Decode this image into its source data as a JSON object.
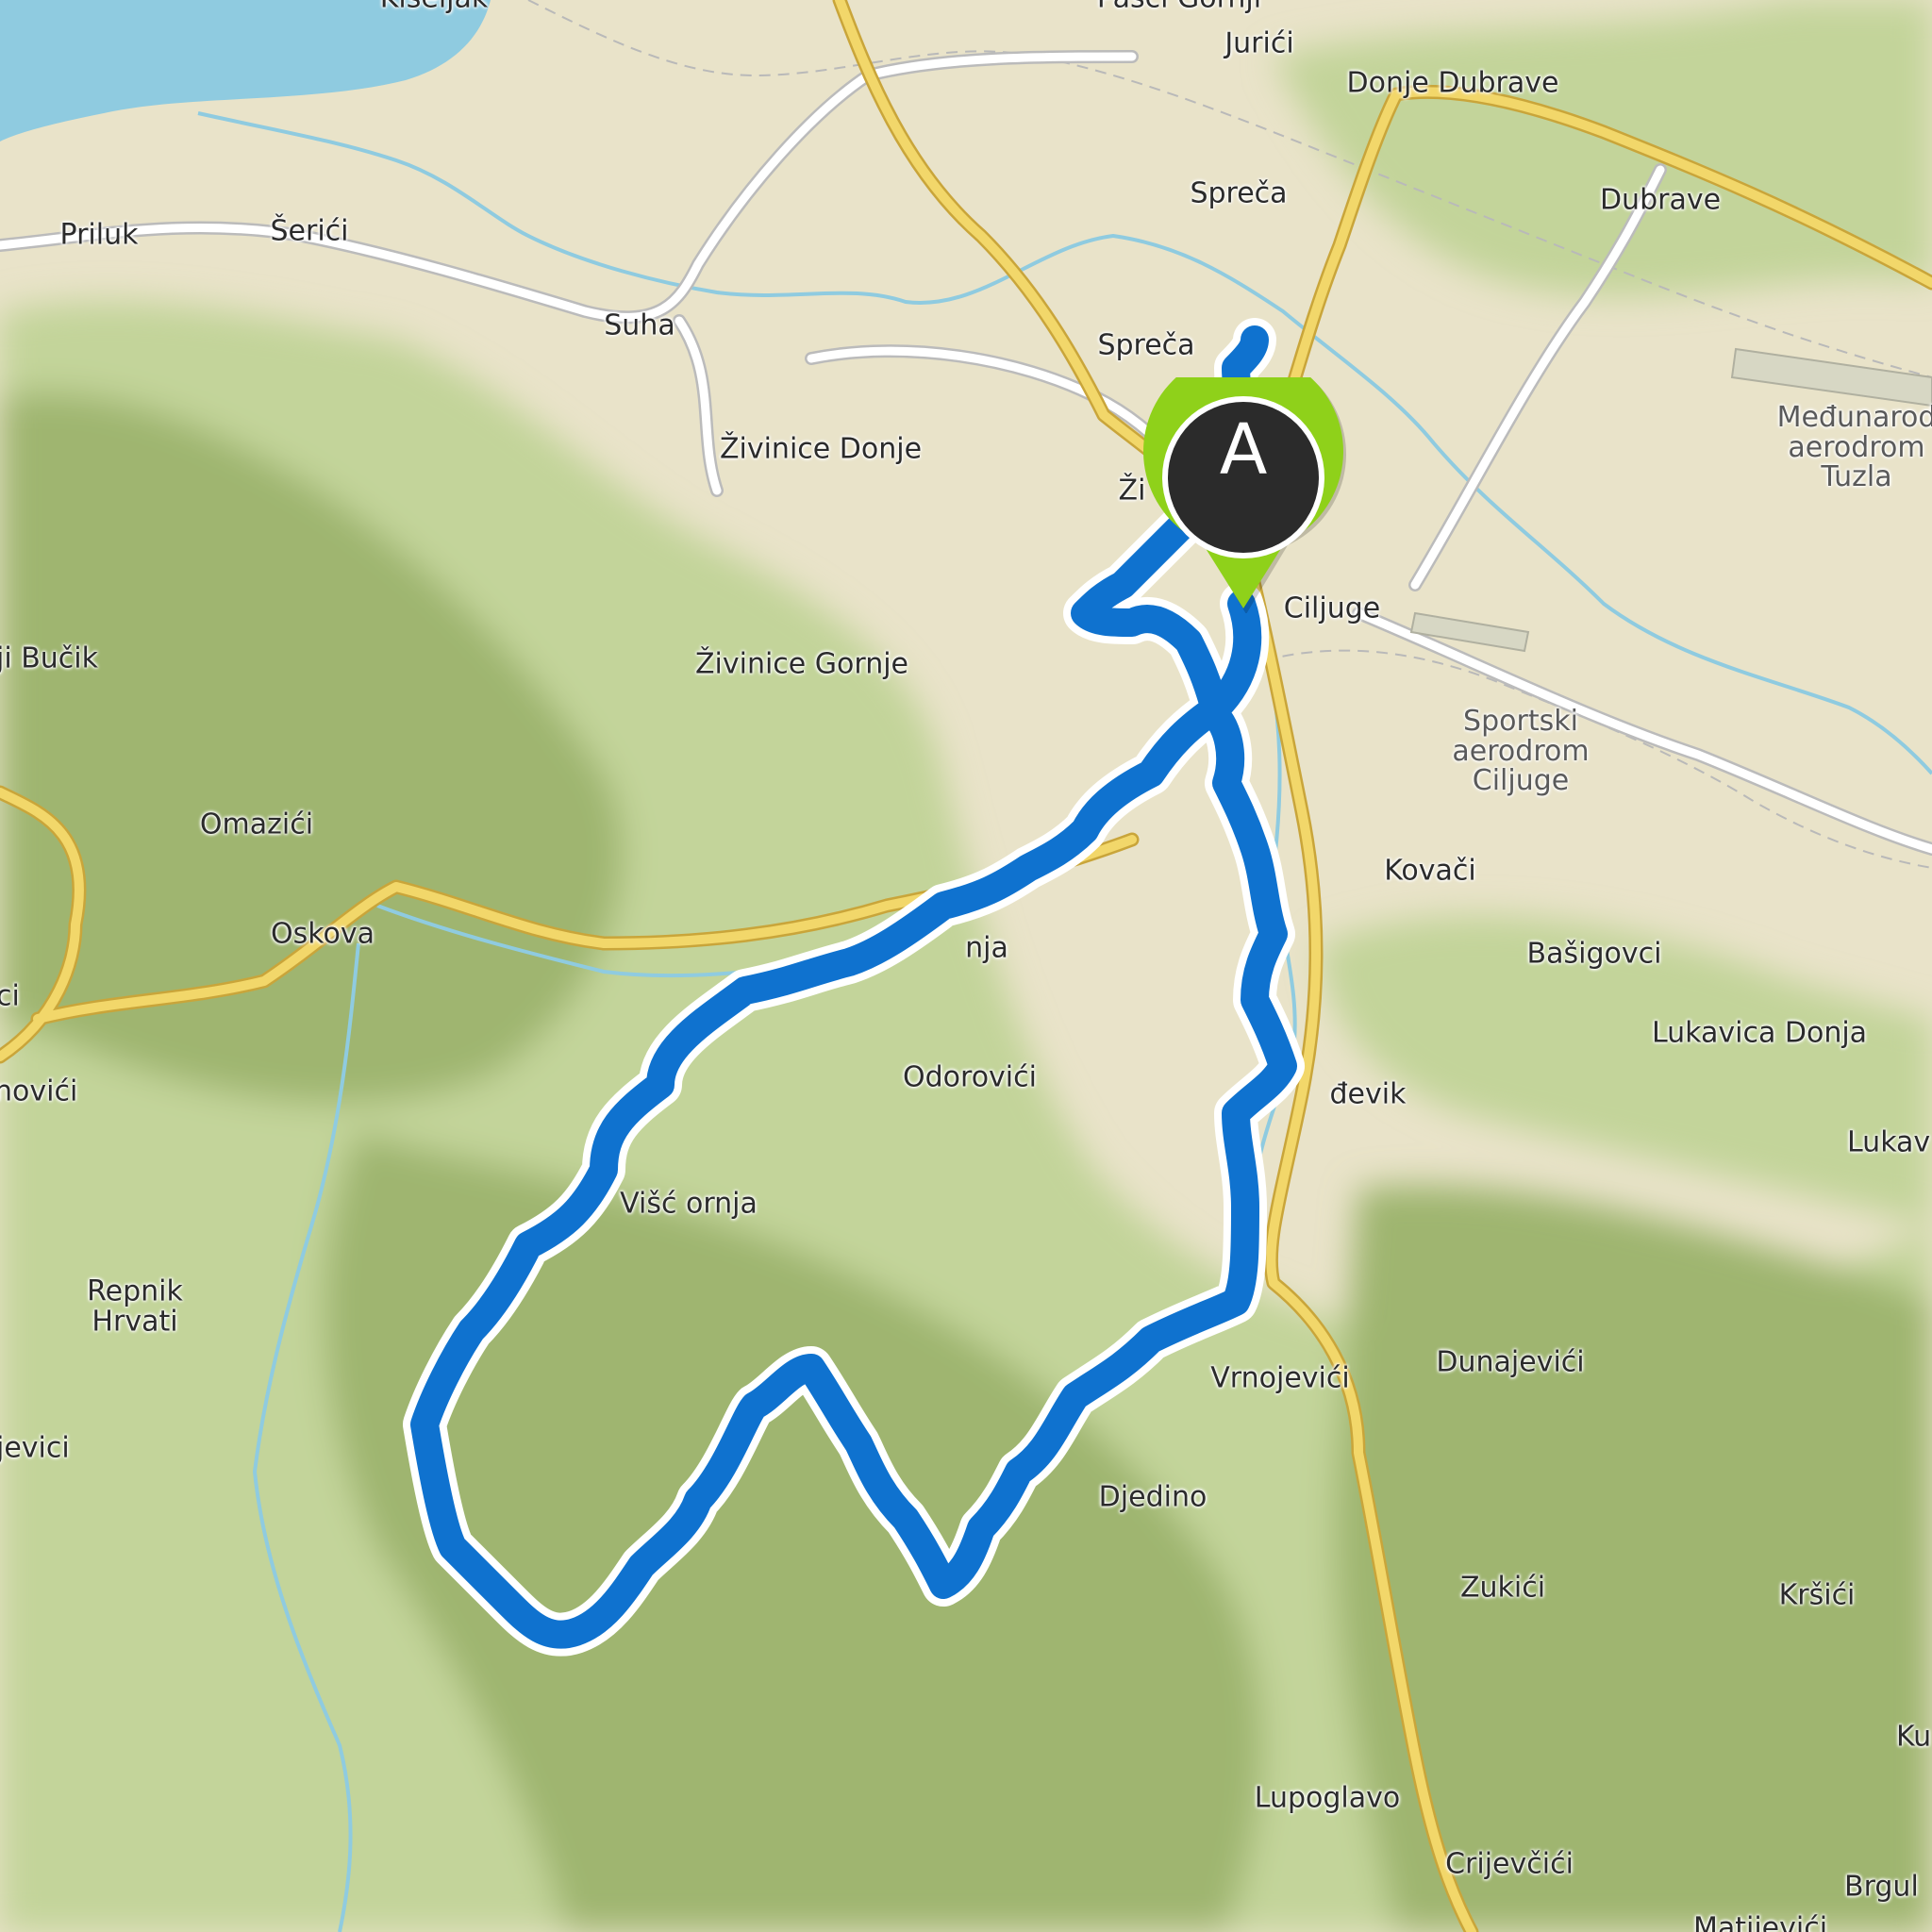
{
  "map": {
    "colors": {
      "lowland": "#e9e3c9",
      "forest": "#c3d49a",
      "forest_dark": "#9fb56f",
      "water": "#8fcbe0",
      "road_major": "#f2d76a",
      "road_minor": "#ffffff",
      "route": "#0f72cf",
      "marker_ring": "#8fd11a",
      "marker_center": "#2b2b2b"
    },
    "marker": {
      "label": "A"
    },
    "places": [
      {
        "id": "kiseljak",
        "name": "Kiseljak"
      },
      {
        "id": "pasci-gornji",
        "name": "Pasci Gornji"
      },
      {
        "id": "jurici",
        "name": "Jurići"
      },
      {
        "id": "donje-dubrave",
        "name": "Donje Dubrave"
      },
      {
        "id": "spreca-1",
        "name": "Spreča"
      },
      {
        "id": "dubrave",
        "name": "Dubrave"
      },
      {
        "id": "priluk",
        "name": "Priluk"
      },
      {
        "id": "serici",
        "name": "Šerići"
      },
      {
        "id": "suha",
        "name": "Suha"
      },
      {
        "id": "spreca-2",
        "name": "Spreča"
      },
      {
        "id": "zivinice-donje",
        "name": "Živinice Donje"
      },
      {
        "id": "zivinice",
        "name": "Ži"
      },
      {
        "id": "airport-tuzla",
        "name": "Međunarod\naerodrom\nTuzla"
      },
      {
        "id": "ciljuge",
        "name": "Ciljuge"
      },
      {
        "id": "bucik",
        "name": "ji Bučik"
      },
      {
        "id": "zivinice-gornje",
        "name": "Živinice Gornje"
      },
      {
        "id": "airport-ciljuge",
        "name": "Sportski\naerodrom\nCiljuge"
      },
      {
        "id": "omazici",
        "name": "Omazići"
      },
      {
        "id": "kovaci",
        "name": "Kovači"
      },
      {
        "id": "oskova",
        "name": "Oskova"
      },
      {
        "id": "bare-donja",
        "name": "nja"
      },
      {
        "id": "basigovci",
        "name": "Bašigovci"
      },
      {
        "id": "ci",
        "name": "ci"
      },
      {
        "id": "lukavica-donja",
        "name": "Lukavica Donja"
      },
      {
        "id": "novici",
        "name": "novići"
      },
      {
        "id": "odorovici",
        "name": "Odorovići"
      },
      {
        "id": "devik",
        "name": "đevik"
      },
      {
        "id": "lukav",
        "name": "Lukav"
      },
      {
        "id": "visca-gornja",
        "name": "Višć    ornja"
      },
      {
        "id": "repnik-hrvati",
        "name": "Repnik\nHrvati"
      },
      {
        "id": "vrnojevici",
        "name": "Vrnojevići"
      },
      {
        "id": "dunajevici",
        "name": "Dunajevići"
      },
      {
        "id": "jevici",
        "name": "jevici"
      },
      {
        "id": "djedino",
        "name": "Djedino"
      },
      {
        "id": "zukici",
        "name": "Zukići"
      },
      {
        "id": "krsici",
        "name": "Kršići"
      },
      {
        "id": "ku",
        "name": "Ku"
      },
      {
        "id": "lupoglavo",
        "name": "Lupoglavo"
      },
      {
        "id": "crijevcici",
        "name": "Crijevčići"
      },
      {
        "id": "brgul",
        "name": "Brgul"
      },
      {
        "id": "matijevici",
        "name": "Matijevići"
      }
    ]
  }
}
